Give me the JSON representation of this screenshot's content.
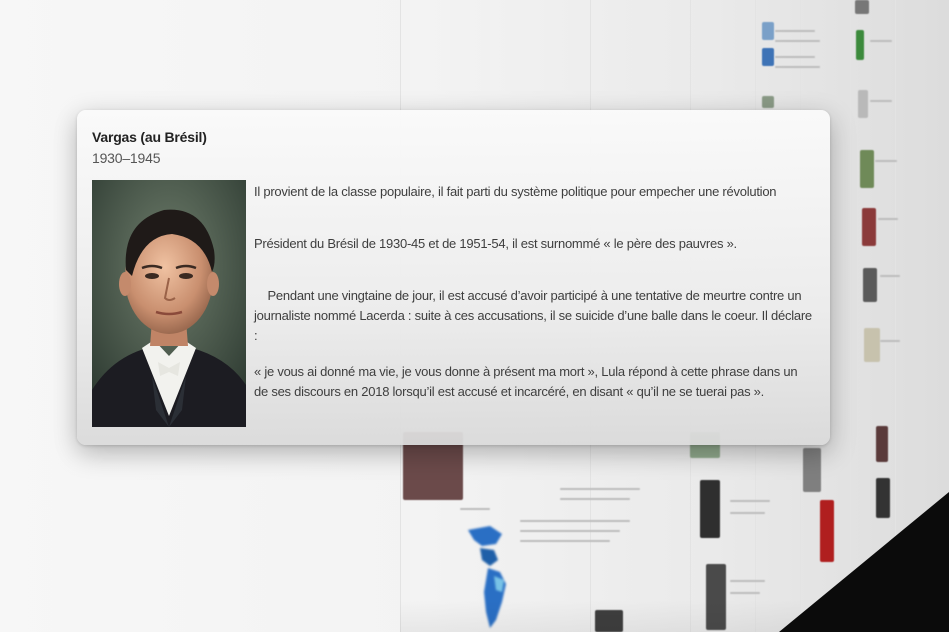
{
  "card": {
    "title": "Vargas (au Brésil)",
    "dates": "1930–1945",
    "paragraphs": [
      "Il provient de la classe populaire, il fait parti du système politique pour empecher une révolution",
      "Président du Brésil de 1930-45 et de 1951-54, il est surnommé « le père des pauvres ».",
      "    Pendant une vingtaine de jour, il est accusé d’avoir participé à une tentative de meurtre contre un journaliste nommé Lacerda : suite à ces accusations, il se suicide d’une balle dans le coeur. Il déclare :",
      "« je vous ai donné ma vie, je vous donne à présent ma mort », Lula répond à cette phrase dans un de ses discours en 2018 lorsqu’il est accusé et incarcéré, en disant « qu’il ne se tuerai pas »."
    ]
  },
  "icons": {
    "portrait": "portrait-photo-icon",
    "map": "americas-map-icon",
    "emblem": "un-emblem-icon"
  },
  "colors": {
    "card_bg": "#f0f0f0",
    "title": "#222222",
    "body_text": "#3e3e3e",
    "map_blue": "#2a6fc4"
  }
}
